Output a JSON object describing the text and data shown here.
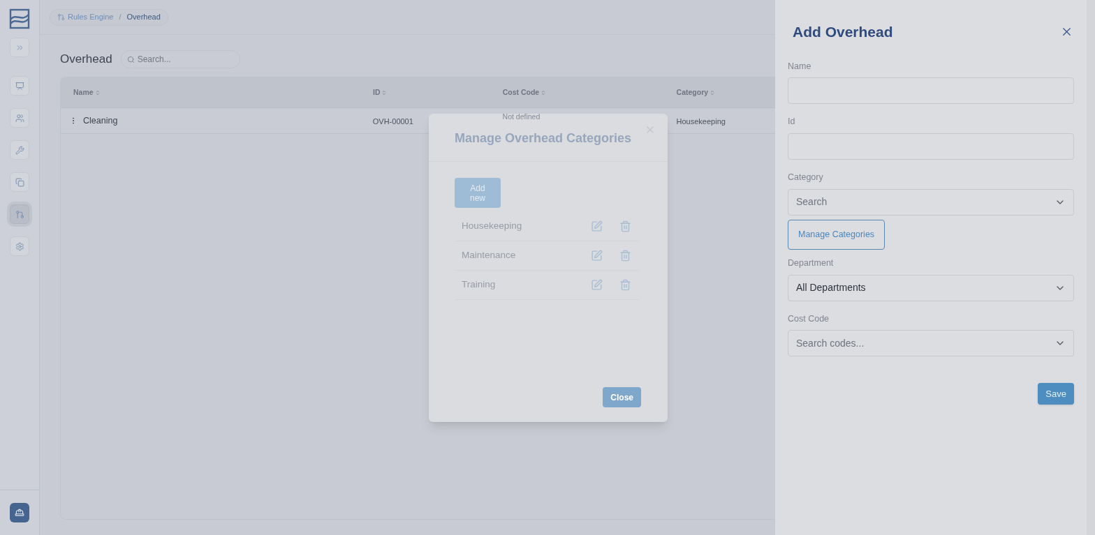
{
  "sidebar": {
    "items": [
      {
        "kind": "expand",
        "selected": false
      },
      {
        "kind": "presentation",
        "selected": false
      },
      {
        "kind": "users",
        "selected": false
      },
      {
        "kind": "wrench",
        "selected": false
      },
      {
        "kind": "copy",
        "selected": false
      },
      {
        "kind": "rules",
        "selected": true
      },
      {
        "kind": "settings",
        "selected": false
      }
    ]
  },
  "breadcrumb": [
    "Rules Engine",
    "/",
    "Overhead"
  ],
  "page": {
    "title": "Overhead",
    "search": {
      "placeholder": "Search..."
    }
  },
  "table": {
    "columns": [
      "Name",
      "ID",
      "Cost Code",
      "Category"
    ],
    "rows": [
      {
        "cells": [
          "Cleaning",
          "OVH-00001",
          "Not defined",
          "Housekeeping"
        ]
      }
    ]
  },
  "modal": {
    "title": "Manage Overhead Categories",
    "add_button": "Add new",
    "categories": [
      "Housekeeping",
      "Maintenance",
      "Training"
    ],
    "close_button": "Close"
  },
  "drawer": {
    "title": "Add Overhead",
    "fields": [
      {
        "label": "Name",
        "kind": "text"
      },
      {
        "label": "Id",
        "kind": "text"
      },
      {
        "label": "Category",
        "kind": "select",
        "placeholder": "Search"
      },
      {
        "kind": "button",
        "label": "Manage Categories"
      },
      {
        "label": "Department",
        "kind": "select",
        "value": "All Departments"
      },
      {
        "label": "Cost Code",
        "kind": "select",
        "placeholder": "Search codes..."
      }
    ],
    "save_button": "Save"
  }
}
